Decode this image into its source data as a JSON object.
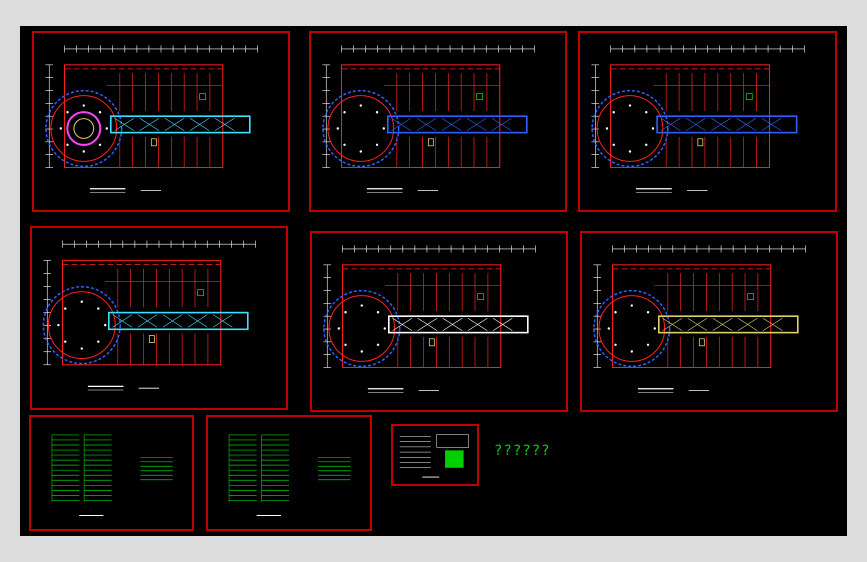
{
  "colors": {
    "background": "#000000",
    "viewport_frame": "#dcdcdc",
    "sheet_border": "#c00000",
    "wall": "#ff2020",
    "corridor": "#3060ff",
    "grid_white": "#ffffff",
    "accent_green": "#00d000",
    "accent_yellow": "#e0d070",
    "accent_cyan": "#40e0ff"
  },
  "sheets": [
    {
      "id": "plan-1",
      "kind": "floor-plan",
      "variant": "hall-magenta"
    },
    {
      "id": "plan-2",
      "kind": "floor-plan",
      "variant": "corridor-blue"
    },
    {
      "id": "plan-3",
      "kind": "floor-plan",
      "variant": "corridor-blue"
    },
    {
      "id": "plan-4",
      "kind": "floor-plan",
      "variant": "corridor-cyan"
    },
    {
      "id": "plan-5",
      "kind": "floor-plan",
      "variant": "corridor-white"
    },
    {
      "id": "plan-6",
      "kind": "floor-plan",
      "variant": "corridor-yellow"
    },
    {
      "id": "schedule-1",
      "kind": "schedule"
    },
    {
      "id": "schedule-2",
      "kind": "schedule"
    },
    {
      "id": "legend",
      "kind": "legend"
    }
  ],
  "caption": "??????"
}
